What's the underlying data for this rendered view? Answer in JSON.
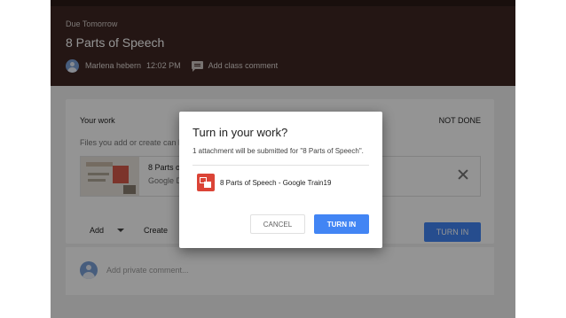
{
  "header": {
    "due_label": "Due Tomorrow",
    "title": "8 Parts of Speech",
    "author_name": "Marlena hebern",
    "time": "12:02 PM",
    "add_class_comment": "Add class comment"
  },
  "work": {
    "your_work_label": "Your work",
    "status": "NOT DONE",
    "files_hint": "Files you add or create can be",
    "attachment_title": "8 Parts of",
    "attachment_sub": "Google D",
    "add_label": "Add",
    "create_label": "Create",
    "turn_in_label": "TURN IN"
  },
  "private_comment": {
    "placeholder": "Add private comment..."
  },
  "dialog": {
    "title": "Turn in your work?",
    "message": "1 attachment will be submitted for \"8 Parts of Speech\".",
    "file_name": "8 Parts of Speech - Google Train19",
    "cancel_label": "CANCEL",
    "confirm_label": "TURN IN"
  },
  "colors": {
    "header_bg": "#3e2723",
    "accent": "#4285f4",
    "slides_icon": "#db4437"
  },
  "icons": {
    "avatar": "avatar-icon",
    "comment": "comment-icon",
    "remove": "close-icon",
    "dropdown": "caret-down-icon",
    "file": "google-slides-icon"
  }
}
